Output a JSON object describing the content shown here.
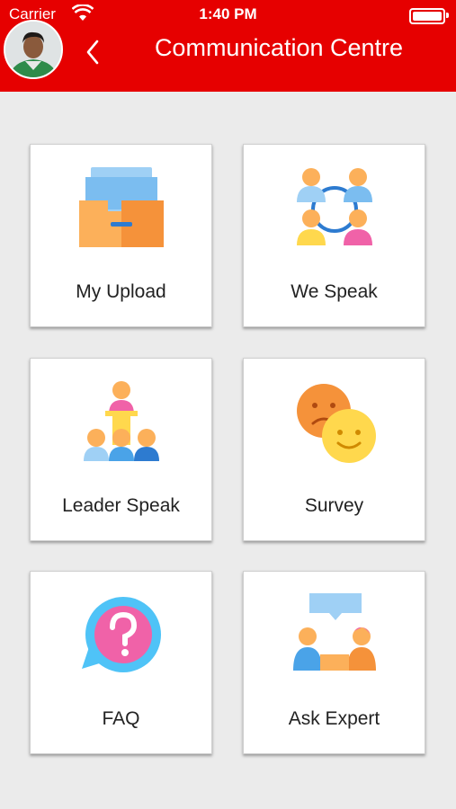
{
  "status_bar": {
    "carrier": "Carrier",
    "time": "1:40 PM"
  },
  "header": {
    "title": "Communication Centre"
  },
  "menu": [
    {
      "label": "My Upload",
      "icon": "upload-tray-icon"
    },
    {
      "label": "We Speak",
      "icon": "people-group-icon"
    },
    {
      "label": "Leader Speak",
      "icon": "leader-podium-icon"
    },
    {
      "label": "Survey",
      "icon": "smiley-faces-icon"
    },
    {
      "label": "FAQ",
      "icon": "question-bubble-icon"
    },
    {
      "label": "Ask Expert",
      "icon": "expert-chat-icon"
    }
  ],
  "colors": {
    "header": "#e60000",
    "background": "#ebebeb",
    "card": "#ffffff"
  }
}
